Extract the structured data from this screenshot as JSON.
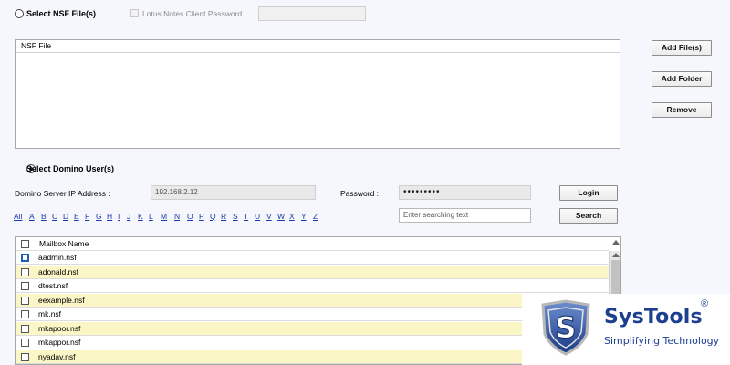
{
  "nsf_section": {
    "radio_label": "Select NSF File(s)",
    "password_label": "Lotus Notes Client Password",
    "list_header": "NSF File",
    "buttons": {
      "add_files": "Add File(s)",
      "add_folder": "Add Folder",
      "remove": "Remove"
    }
  },
  "domino_section": {
    "radio_label": "Select Domino User(s)",
    "server_label": "Domino Server IP Address :",
    "server_value": "192.168.2.12",
    "password_label": "Password :",
    "password_value": "•••••••••",
    "login_button": "Login",
    "search_placeholder": "Enter searching text",
    "search_button": "Search"
  },
  "alphabet": [
    "All",
    "A",
    "B",
    "C",
    "D",
    "E",
    "F",
    "G",
    "H",
    "I",
    "J",
    "K",
    "L",
    "M",
    "N",
    "O",
    "P",
    "Q",
    "R",
    "S",
    "T",
    "U",
    "V",
    "W",
    "X",
    "Y",
    "Z"
  ],
  "mailbox_table": {
    "header": "Mailbox Name",
    "rows": [
      "aadmin.nsf",
      "adonald.nsf",
      "dtest.nsf",
      "eexample.nsf",
      "mk.nsf",
      "mkapoor.nsf",
      "mkappor.nsf",
      "nyadav.nsf"
    ]
  },
  "brand": {
    "name": "SysTools",
    "registered": "®",
    "tagline": "Simplifying Technology",
    "logo_letter": "S",
    "color": "#1c3f8f"
  }
}
